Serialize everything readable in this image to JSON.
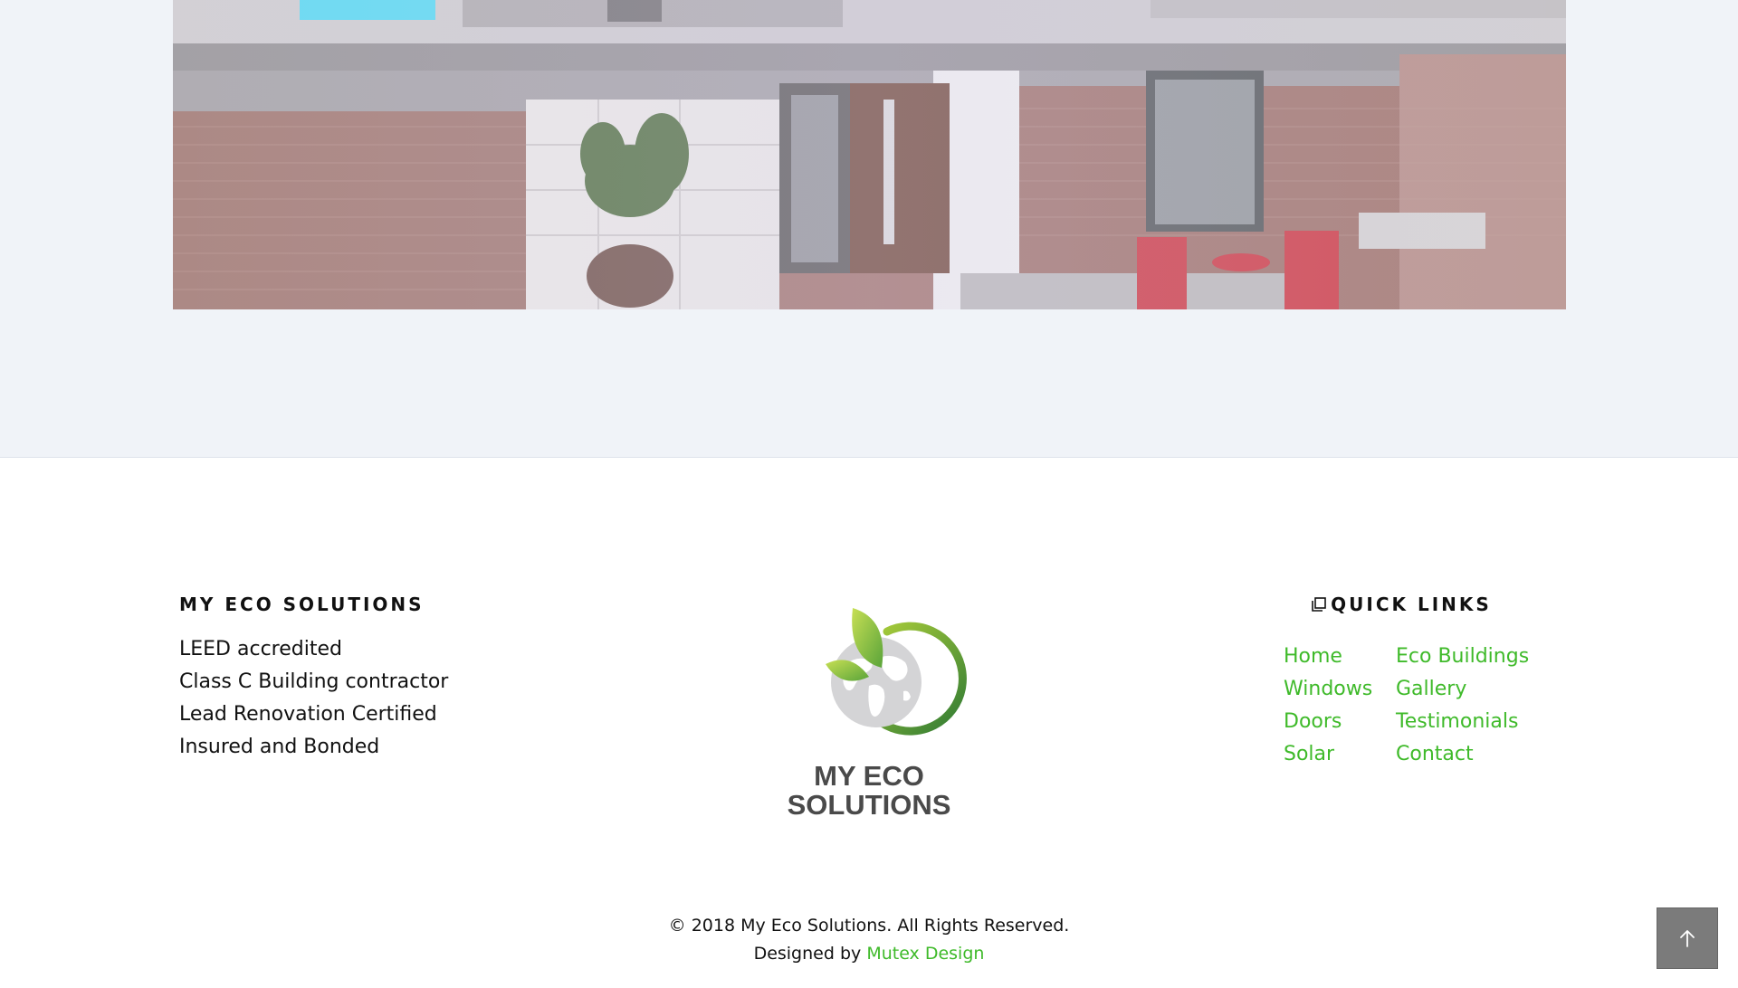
{
  "hero": {
    "alt": "house exterior video frame"
  },
  "footer": {
    "about": {
      "heading": "MY ECO SOLUTIONS",
      "items": [
        "LEED accredited",
        "Class C Building contractor",
        "Lead Renovation Certified",
        "Insured and Bonded"
      ]
    },
    "logo": {
      "line1": "MY ECO",
      "line2": "SOLUTIONS"
    },
    "quick_links": {
      "heading": "QUICK LINKS",
      "icon": "copy-icon",
      "col1": [
        "Home",
        "Windows",
        "Doors",
        "Solar"
      ],
      "col2": [
        "Eco Buildings",
        "Gallery",
        "Testimonials",
        "Contact"
      ]
    },
    "copyright": "© 2018 My Eco Solutions. All Rights Reserved.",
    "designed_by_prefix": "Designed by",
    "designer": "Mutex Design"
  },
  "back_to_top": {
    "icon": "arrow-up-icon"
  },
  "colors": {
    "accent": "#3fba2a",
    "band": "#f0f3f8",
    "button": "#7b7b7b"
  }
}
